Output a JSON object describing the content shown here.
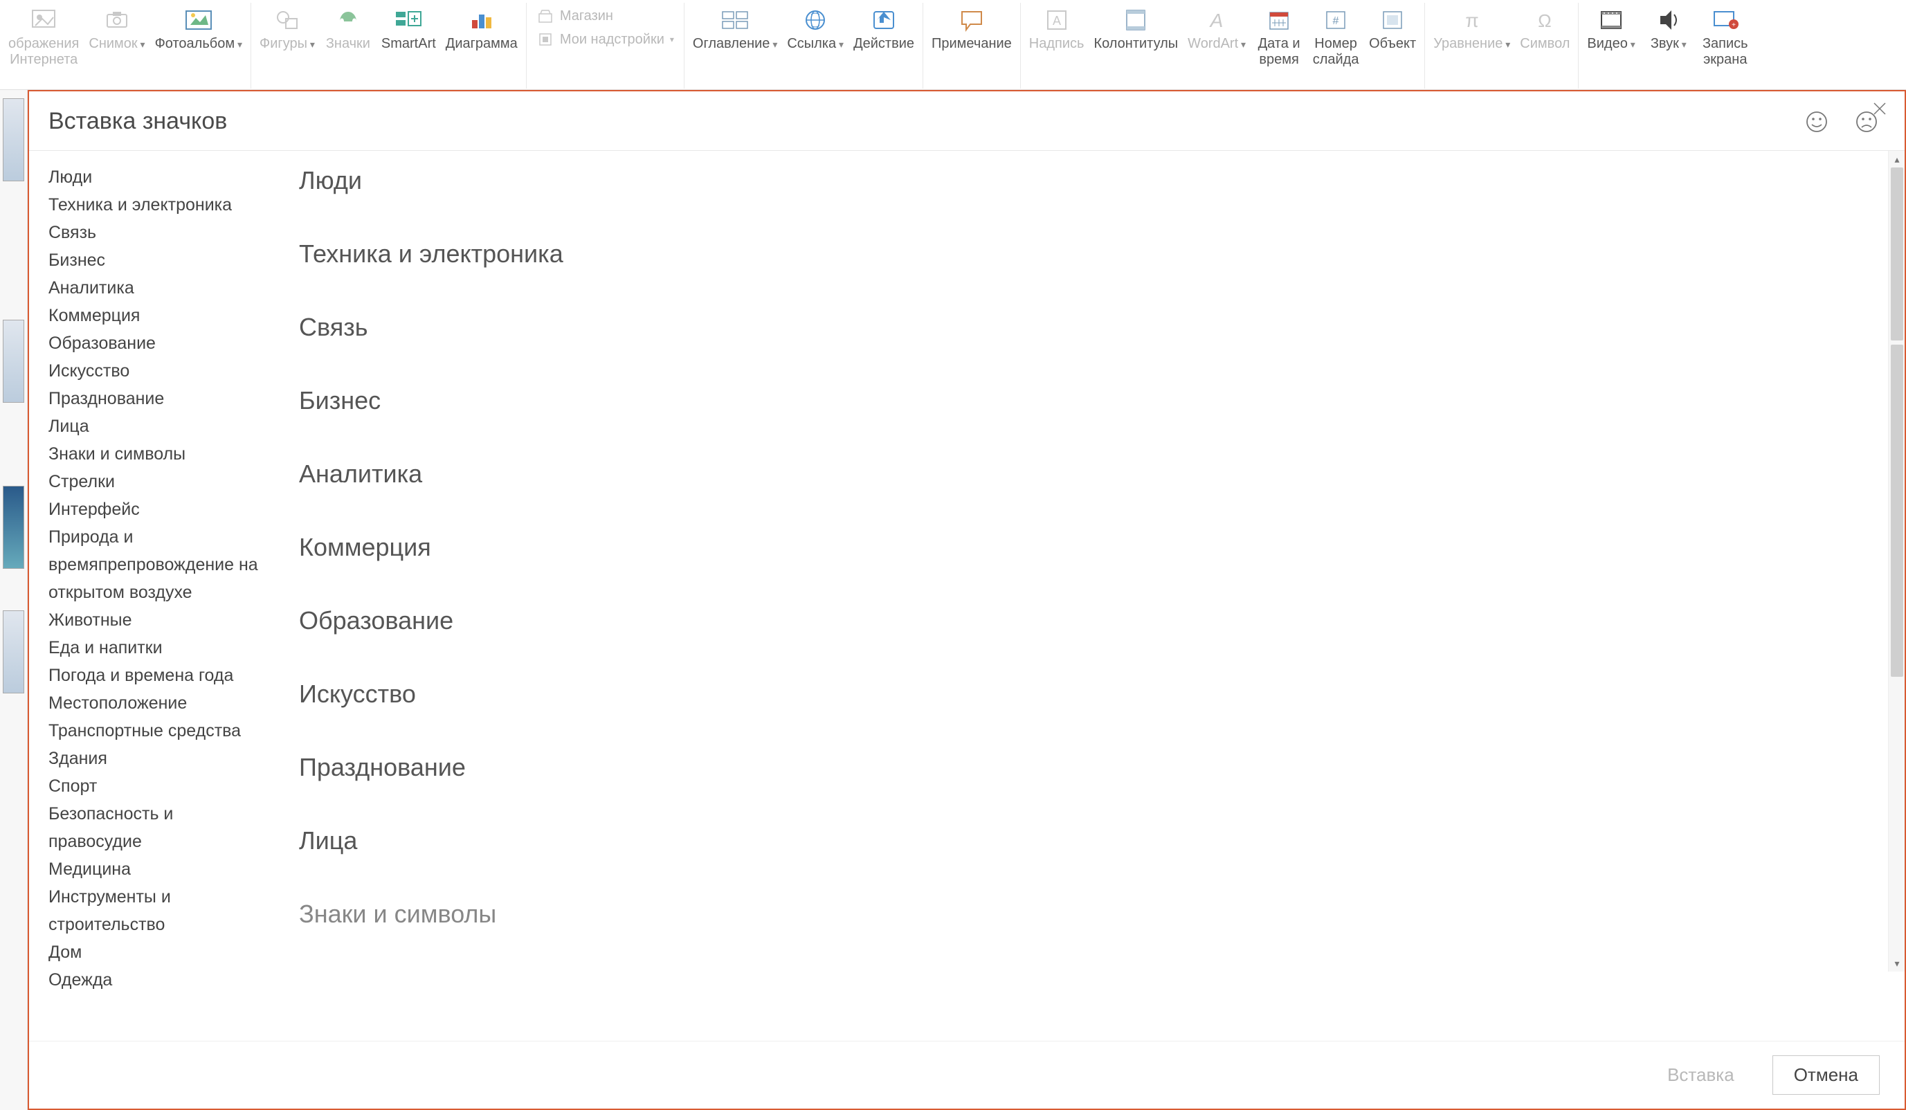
{
  "ribbon": {
    "items": [
      {
        "id": "images-internet",
        "label": "ображения\nИнтернета",
        "disabled": true,
        "dropdown": false
      },
      {
        "id": "screenshot",
        "label": "Снимок",
        "disabled": true,
        "dropdown": true
      },
      {
        "id": "photoalbum",
        "label": "Фотоальбом",
        "disabled": false,
        "dropdown": true
      },
      {
        "id": "shapes",
        "label": "Фигуры",
        "disabled": true,
        "dropdown": true
      },
      {
        "id": "icons",
        "label": "Значки",
        "disabled": true,
        "dropdown": false
      },
      {
        "id": "smartart",
        "label": "SmartArt",
        "disabled": false,
        "dropdown": false
      },
      {
        "id": "chart",
        "label": "Диаграмма",
        "disabled": false,
        "dropdown": false
      },
      {
        "id": "toc",
        "label": "Оглавление",
        "disabled": false,
        "dropdown": true
      },
      {
        "id": "link",
        "label": "Ссылка",
        "disabled": false,
        "dropdown": true
      },
      {
        "id": "action",
        "label": "Действие",
        "disabled": false,
        "dropdown": false
      },
      {
        "id": "comment",
        "label": "Примечание",
        "disabled": false,
        "dropdown": false
      },
      {
        "id": "textbox",
        "label": "Надпись",
        "disabled": true,
        "dropdown": false
      },
      {
        "id": "headerfooter",
        "label": "Колонтитулы",
        "disabled": false,
        "dropdown": false
      },
      {
        "id": "wordart",
        "label": "WordArt",
        "disabled": true,
        "dropdown": true
      },
      {
        "id": "datetime",
        "label": "Дата и\nвремя",
        "disabled": false,
        "dropdown": false
      },
      {
        "id": "slidenum",
        "label": "Номер\nслайда",
        "disabled": false,
        "dropdown": false
      },
      {
        "id": "object",
        "label": "Объект",
        "disabled": false,
        "dropdown": false
      },
      {
        "id": "equation",
        "label": "Уравнение",
        "disabled": true,
        "dropdown": true
      },
      {
        "id": "symbol",
        "label": "Символ",
        "disabled": true,
        "dropdown": false
      },
      {
        "id": "video",
        "label": "Видео",
        "disabled": false,
        "dropdown": true
      },
      {
        "id": "audio",
        "label": "Звук",
        "disabled": false,
        "dropdown": true
      },
      {
        "id": "screenrec",
        "label": "Запись\nэкрана",
        "disabled": false,
        "dropdown": false
      }
    ],
    "addins": {
      "store": "Магазин",
      "my": "Мои надстройки"
    }
  },
  "dialog": {
    "title": "Вставка значков",
    "sidebar": {
      "items": [
        "Люди",
        "Техника и электроника",
        "Связь",
        "Бизнес",
        "Аналитика",
        "Коммерция",
        "Образование",
        "Искусство",
        "Празднование",
        "Лица",
        "Знаки и символы",
        "Стрелки",
        "Интерфейс",
        "Природа и времяпрепровождение на открытом воздухе",
        "Животные",
        "Еда и напитки",
        "Погода и времена года",
        "Местоположение",
        "Транспортные средства",
        "Здания",
        "Спорт",
        "Безопасность и правосудие",
        "Медицина",
        "Инструменты и строительство",
        "Дом",
        "Одежда"
      ]
    },
    "content_sections": [
      "Люди",
      "Техника и электроника",
      "Связь",
      "Бизнес",
      "Аналитика",
      "Коммерция",
      "Образование",
      "Искусство",
      "Празднование",
      "Лица",
      "Знаки и символы"
    ],
    "footer": {
      "insert": "Вставка",
      "cancel": "Отмена"
    }
  }
}
